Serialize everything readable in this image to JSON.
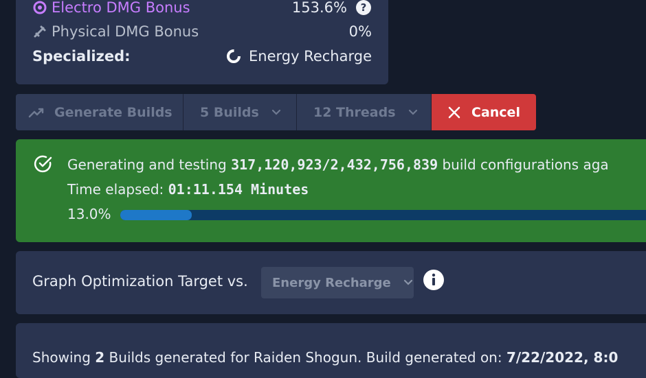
{
  "stats": {
    "electro_label": "Electro DMG Bonus",
    "electro_value": "153.6%",
    "physical_label": "Physical DMG Bonus",
    "physical_value": "0%",
    "specialized_label": "Specialized:",
    "specialized_value": "Energy Recharge"
  },
  "toolbar": {
    "generate_label": "Generate Builds",
    "builds_label": "5 Builds",
    "threads_label": "12 Threads",
    "cancel_label": "Cancel"
  },
  "progress": {
    "prefix": "Generating and testing",
    "count": "317,120,923/2,432,756,839",
    "suffix": "build configurations aga",
    "time_label": "Time elapsed:",
    "time_value": "01:11.154 Minutes",
    "percent_text": "13.0%",
    "fraction": 0.13
  },
  "graph": {
    "label": "Graph Optimization Target vs.",
    "select_value": "Energy Recharge"
  },
  "results": {
    "showing_prefix": "Showing",
    "build_count": "2",
    "showing_mid": "Builds generated for Raiden Shogun. Build generated on:",
    "date": "7/22/2022, 8:0"
  },
  "colors": {
    "electro": "#c77dff",
    "success": "#2e7d32",
    "cancel": "#d0393a",
    "bar_fill": "#1e78c8",
    "bar_track": "#0d3b66"
  },
  "icons": {
    "electro": "electro-element-icon",
    "physical": "physical-sword-icon",
    "help": "help-circle-icon",
    "energy": "energy-recharge-icon",
    "trend": "trending-up-icon",
    "close": "close-icon",
    "check": "check-circle-icon",
    "info": "info-icon",
    "chevron": "chevron-down-icon"
  }
}
